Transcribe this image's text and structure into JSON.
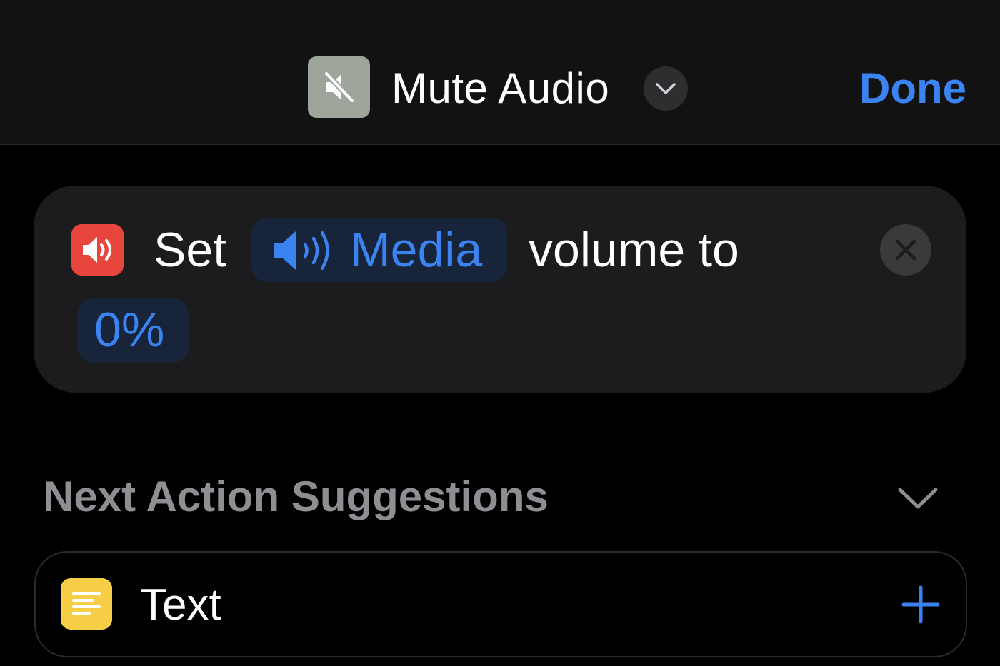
{
  "header": {
    "shortcut_icon": "speaker-mute-icon",
    "title": "Mute Audio",
    "title_menu_icon": "chevron-down-icon",
    "done_label": "Done"
  },
  "action": {
    "icon": "speaker-wave-icon",
    "icon_color": "#e8453c",
    "verb": "Set",
    "target_icon": "speaker-wave-icon",
    "target": "Media",
    "suffix": "volume to",
    "value": "0%",
    "remove_icon": "close-icon"
  },
  "suggestions": {
    "title": "Next Action Suggestions",
    "toggle_icon": "chevron-down-icon",
    "items": [
      {
        "icon": "text-lines-icon",
        "icon_color": "#f6cf47",
        "label": "Text",
        "add_icon": "plus-icon"
      }
    ]
  },
  "colors": {
    "accent": "#3a83f1",
    "background": "#000000",
    "card": "#1c1c1e"
  }
}
